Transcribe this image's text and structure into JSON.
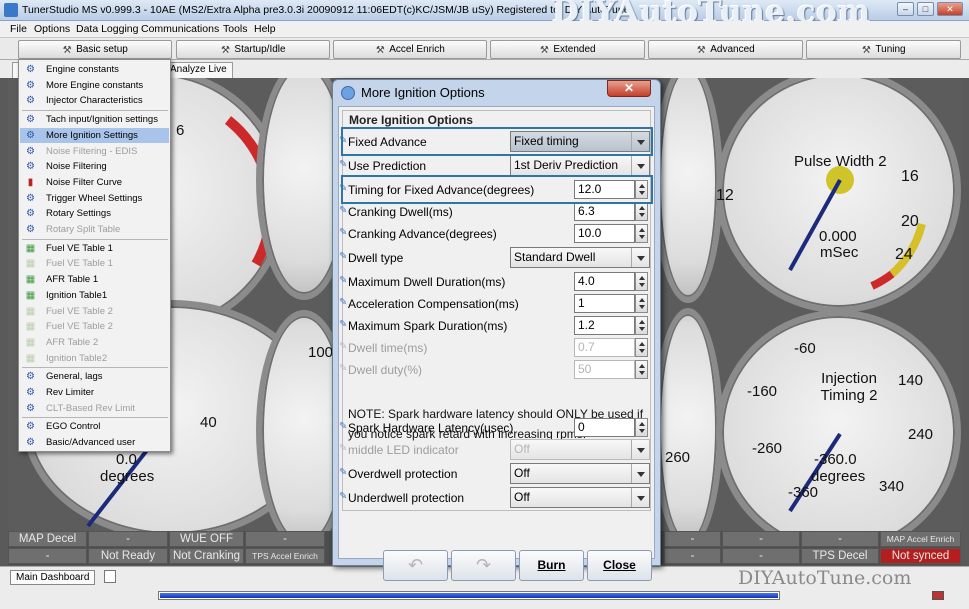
{
  "window": {
    "title": "TunerStudio MS v0.999.3 - 10AE (MS2/Extra Alpha pre3.0.3i 20090912 11:06EDT(c)KC/JSM/JB uSy) Registered to: DIY AutoTune",
    "brand": "DIYAutoTune.com",
    "controls": [
      "–",
      "□",
      "✕"
    ]
  },
  "menubar": [
    "File",
    "Options",
    "Data Logging",
    "Communications",
    "Tools",
    "Help"
  ],
  "toolbar": [
    {
      "label": "Basic setup",
      "icon": "wrench-icon"
    },
    {
      "label": "Startup/Idle",
      "icon": "wrench-icon"
    },
    {
      "label": "Accel Enrich",
      "icon": "wrench-icon"
    },
    {
      "label": "Extended",
      "icon": "wrench-icon"
    },
    {
      "label": "Advanced",
      "icon": "wrench-icon"
    },
    {
      "label": "Tuning",
      "icon": "wrench-icon"
    }
  ],
  "tabs": [
    "Analyze Live"
  ],
  "basic_menu": {
    "groups": [
      [
        {
          "label": "Engine constants",
          "state": "normal"
        },
        {
          "label": "More Engine constants",
          "state": "normal"
        },
        {
          "label": "Injector Characteristics",
          "state": "normal"
        }
      ],
      [
        {
          "label": "Tach input/Ignition settings",
          "state": "normal"
        },
        {
          "label": "More Ignition Settings",
          "state": "selected"
        },
        {
          "label": "Noise Filtering - EDIS",
          "state": "disabled"
        },
        {
          "label": "Noise Filtering",
          "state": "normal"
        },
        {
          "label": "Noise Filter Curve",
          "state": "normal"
        },
        {
          "label": "Trigger Wheel Settings",
          "state": "normal"
        },
        {
          "label": "Rotary Settings",
          "state": "normal"
        },
        {
          "label": "Rotary Split Table",
          "state": "disabled"
        }
      ],
      [
        {
          "label": "Fuel VE Table 1",
          "state": "normal"
        },
        {
          "label": "Fuel VE Table 1",
          "state": "disabled"
        },
        {
          "label": "AFR Table 1",
          "state": "normal"
        },
        {
          "label": "Ignition Table1",
          "state": "normal"
        },
        {
          "label": "Fuel VE Table 2",
          "state": "disabled"
        },
        {
          "label": "Fuel VE Table 2",
          "state": "disabled"
        },
        {
          "label": "AFR Table 2",
          "state": "disabled"
        },
        {
          "label": "Ignition Table2",
          "state": "disabled"
        }
      ],
      [
        {
          "label": "General, lags",
          "state": "normal"
        },
        {
          "label": "Rev Limiter",
          "state": "normal"
        },
        {
          "label": "CLT-Based Rev Limit",
          "state": "disabled"
        }
      ],
      [
        {
          "label": "EGO Control",
          "state": "normal"
        },
        {
          "label": "Basic/Advanced user",
          "state": "normal"
        }
      ]
    ]
  },
  "gauges": {
    "pulse_width": {
      "title": "Pulse Width 2",
      "value": "0.000",
      "unit": "mSec",
      "ticks": [
        "12",
        "16",
        "20",
        "24"
      ]
    },
    "injection_timing": {
      "title": "Injection Timing 2",
      "value": "-360.0",
      "unit": "degrees",
      "ticks": [
        "-60",
        "140",
        "-160",
        "240",
        "-260",
        "340",
        "-360"
      ]
    },
    "left_lower": {
      "value": "0.0",
      "unit": "degrees",
      "ticks": [
        "40"
      ]
    },
    "left_upper": {
      "ticks": [
        "6"
      ]
    },
    "center_left": {
      "ticks": [
        "100"
      ]
    },
    "center_right": {
      "ticks": [
        "260"
      ]
    }
  },
  "bottom_grid": {
    "row1": [
      "MAP Decel",
      "-",
      "WUE OFF",
      "-",
      "-",
      "-",
      "-",
      "MAP Accel Enrich"
    ],
    "row2": [
      "-",
      "Not Ready",
      "Not Cranking",
      "TPS Accel Enrich",
      "-",
      "-",
      "TPS Decel",
      "Not synced"
    ]
  },
  "status": {
    "main_tab": "Main Dashboard",
    "watermark": "DIYAutoTune.com",
    "progress": 1.0
  },
  "dialog": {
    "title": "More Ignition Options",
    "section": "More Ignition Options",
    "rows": [
      {
        "label": "Fixed Advance",
        "type": "select",
        "value": "Fixed timing",
        "enabled": true,
        "focused": true
      },
      {
        "label": "Use Prediction",
        "type": "select",
        "value": "1st Deriv Prediction",
        "enabled": true
      },
      {
        "label": "Timing for Fixed Advance(degrees)",
        "type": "number",
        "value": "12.0",
        "enabled": true,
        "focused": true
      },
      {
        "label": "Cranking Dwell(ms)",
        "type": "number",
        "value": "6.3",
        "enabled": true
      },
      {
        "label": "Cranking Advance(degrees)",
        "type": "number",
        "value": "10.0",
        "enabled": true
      },
      {
        "label": "Dwell type",
        "type": "select",
        "value": "Standard Dwell",
        "enabled": true
      },
      {
        "label": "Maximum Dwell Duration(ms)",
        "type": "number",
        "value": "4.0",
        "enabled": true
      },
      {
        "label": "Acceleration Compensation(ms)",
        "type": "number",
        "value": "1",
        "enabled": true
      },
      {
        "label": "Maximum Spark Duration(ms)",
        "type": "number",
        "value": "1.2",
        "enabled": true
      },
      {
        "label": "Dwell time(ms)",
        "type": "number",
        "value": "0.7",
        "enabled": false
      },
      {
        "label": "Dwell duty(%)",
        "type": "number",
        "value": "50",
        "enabled": false
      }
    ],
    "note_line1": "NOTE: Spark hardware latency should ONLY be used if",
    "note_line2": "you notice spark retard with increasing rpms.",
    "rows2": [
      {
        "label": "Spark Hardware Latency(usec)",
        "type": "number",
        "value": "0",
        "enabled": true
      },
      {
        "label": "middle LED indicator",
        "type": "select",
        "value": "Off",
        "enabled": false
      },
      {
        "label": "Overdwell protection",
        "type": "select",
        "value": "Off",
        "enabled": true
      },
      {
        "label": "Underdwell protection",
        "type": "select",
        "value": "Off",
        "enabled": true
      }
    ],
    "buttons": {
      "burn": "Burn",
      "close": "Close",
      "undo_icon": "undo-icon",
      "redo_icon": "redo-icon"
    }
  }
}
